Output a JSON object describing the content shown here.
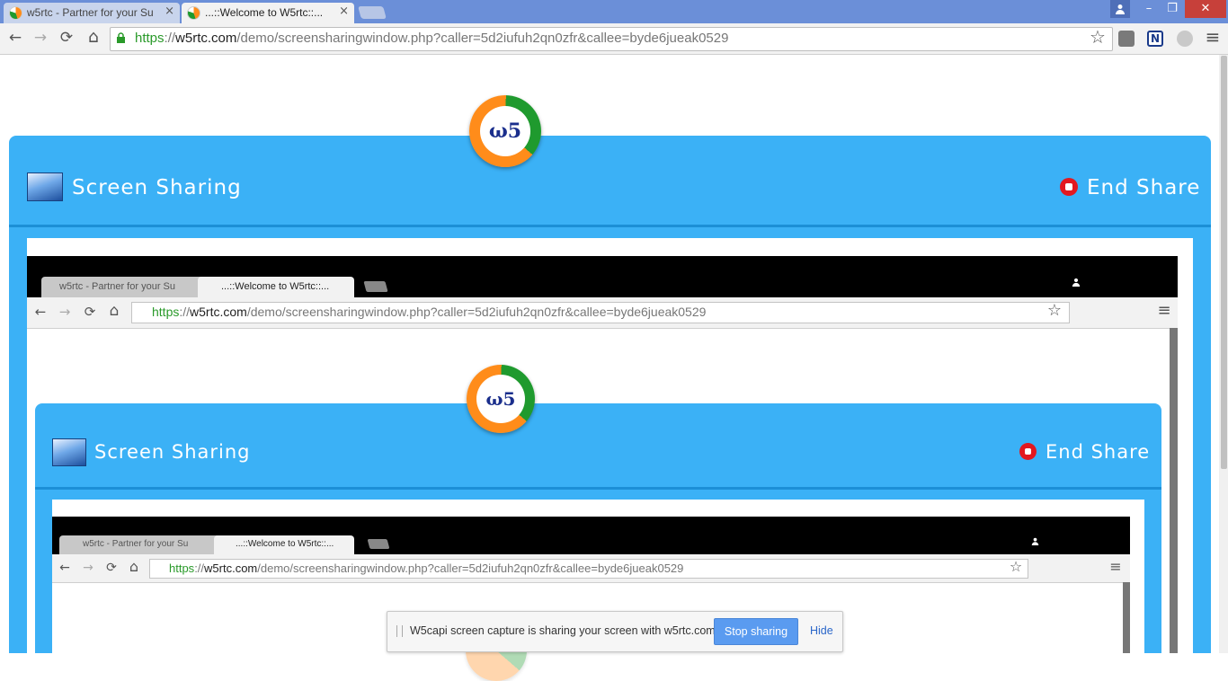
{
  "browser": {
    "tabs": [
      {
        "label": "w5rtc - Partner for your Su",
        "close": "×"
      },
      {
        "label": "...::Welcome to W5rtc::...",
        "close": "×"
      }
    ],
    "window_controls": {
      "minimize": "–",
      "restore": "❐",
      "close": "✕"
    },
    "nav": {
      "back": "←",
      "forward": "→",
      "reload": "⟳",
      "home": "⌂"
    },
    "url": {
      "scheme": "https",
      "sep": "://",
      "host": "w5rtc.com",
      "path": "/demo/screensharingwindow.php?caller=5d2iufuh2qn0zfr&callee=byde6jueak0529"
    },
    "star": "☆",
    "menu": "≡"
  },
  "app": {
    "logo_text": "ω5",
    "title": "Screen Sharing",
    "end_share": "End Share"
  },
  "notification": {
    "message": "W5capi screen capture is sharing your screen with w5rtc.com.",
    "stop_label": "Stop sharing",
    "hide_label": "Hide"
  },
  "colors": {
    "panel": "#3bb1f6",
    "titlebar": "#6b8fd8",
    "https_green": "#2a9a2a",
    "stop_red": "#e3181f"
  }
}
